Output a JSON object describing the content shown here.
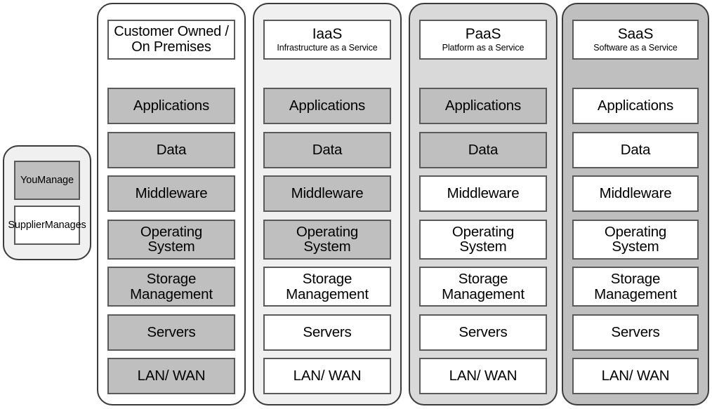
{
  "legend": {
    "name": "responsibility-legend",
    "items": [
      {
        "id": "you-manage",
        "label_line1": "You",
        "label_line2": "Manage",
        "fill": "managed"
      },
      {
        "id": "supplier-manages",
        "label_line1": "Supplier",
        "label_line2": "Manages",
        "fill": "supplied"
      }
    ]
  },
  "colors": {
    "managed_fill": "#bfbfbf",
    "supplied_fill": "#ffffff",
    "panel_border": "#3b3b3b",
    "box_border": "#5a5a5a",
    "column_bg_0": "#ffffff",
    "column_bg_1": "#f0f0f0",
    "column_bg_2": "#d9d9d9",
    "column_bg_3": "#bfbfbf"
  },
  "layer_names": [
    "Applications",
    "Data",
    "Middleware",
    "Operating System",
    "Storage Management",
    "Servers",
    "LAN/ WAN"
  ],
  "columns": [
    {
      "id": "customer-owned",
      "header": {
        "title_line1": "Customer Owned /",
        "title_line2": "On Premises",
        "subtitle": ""
      },
      "layers": [
        {
          "label": "Applications",
          "line1": "Applications",
          "line2": "",
          "fill": "managed"
        },
        {
          "label": "Data",
          "line1": "Data",
          "line2": "",
          "fill": "managed"
        },
        {
          "label": "Middleware",
          "line1": "Middleware",
          "line2": "",
          "fill": "managed"
        },
        {
          "label": "Operating System",
          "line1": "Operating",
          "line2": "System",
          "fill": "managed"
        },
        {
          "label": "Storage Management",
          "line1": "Storage",
          "line2": "Management",
          "fill": "managed"
        },
        {
          "label": "Servers",
          "line1": "Servers",
          "line2": "",
          "fill": "managed"
        },
        {
          "label": "LAN/ WAN",
          "line1": "LAN/ WAN",
          "line2": "",
          "fill": "managed"
        }
      ]
    },
    {
      "id": "iaas",
      "header": {
        "title_line1": "IaaS",
        "title_line2": "",
        "subtitle": "Infrastructure as a Service"
      },
      "layers": [
        {
          "label": "Applications",
          "line1": "Applications",
          "line2": "",
          "fill": "managed"
        },
        {
          "label": "Data",
          "line1": "Data",
          "line2": "",
          "fill": "managed"
        },
        {
          "label": "Middleware",
          "line1": "Middleware",
          "line2": "",
          "fill": "managed"
        },
        {
          "label": "Operating System",
          "line1": "Operating",
          "line2": "System",
          "fill": "managed"
        },
        {
          "label": "Storage Management",
          "line1": "Storage",
          "line2": "Management",
          "fill": "supplied"
        },
        {
          "label": "Servers",
          "line1": "Servers",
          "line2": "",
          "fill": "supplied"
        },
        {
          "label": "LAN/ WAN",
          "line1": "LAN/ WAN",
          "line2": "",
          "fill": "supplied"
        }
      ]
    },
    {
      "id": "paas",
      "header": {
        "title_line1": "PaaS",
        "title_line2": "",
        "subtitle": "Platform as a Service"
      },
      "layers": [
        {
          "label": "Applications",
          "line1": "Applications",
          "line2": "",
          "fill": "managed"
        },
        {
          "label": "Data",
          "line1": "Data",
          "line2": "",
          "fill": "managed"
        },
        {
          "label": "Middleware",
          "line1": "Middleware",
          "line2": "",
          "fill": "supplied"
        },
        {
          "label": "Operating System",
          "line1": "Operating",
          "line2": "System",
          "fill": "supplied"
        },
        {
          "label": "Storage Management",
          "line1": "Storage",
          "line2": "Management",
          "fill": "supplied"
        },
        {
          "label": "Servers",
          "line1": "Servers",
          "line2": "",
          "fill": "supplied"
        },
        {
          "label": "LAN/ WAN",
          "line1": "LAN/ WAN",
          "line2": "",
          "fill": "supplied"
        }
      ]
    },
    {
      "id": "saas",
      "header": {
        "title_line1": "SaaS",
        "title_line2": "",
        "subtitle": "Software as a Service"
      },
      "layers": [
        {
          "label": "Applications",
          "line1": "Applications",
          "line2": "",
          "fill": "supplied"
        },
        {
          "label": "Data",
          "line1": "Data",
          "line2": "",
          "fill": "supplied"
        },
        {
          "label": "Middleware",
          "line1": "Middleware",
          "line2": "",
          "fill": "supplied"
        },
        {
          "label": "Operating System",
          "line1": "Operating",
          "line2": "System",
          "fill": "supplied"
        },
        {
          "label": "Storage Management",
          "line1": "Storage",
          "line2": "Management",
          "fill": "supplied"
        },
        {
          "label": "Servers",
          "line1": "Servers",
          "line2": "",
          "fill": "supplied"
        },
        {
          "label": "LAN/ WAN",
          "line1": "LAN/ WAN",
          "line2": "",
          "fill": "supplied"
        }
      ]
    }
  ]
}
